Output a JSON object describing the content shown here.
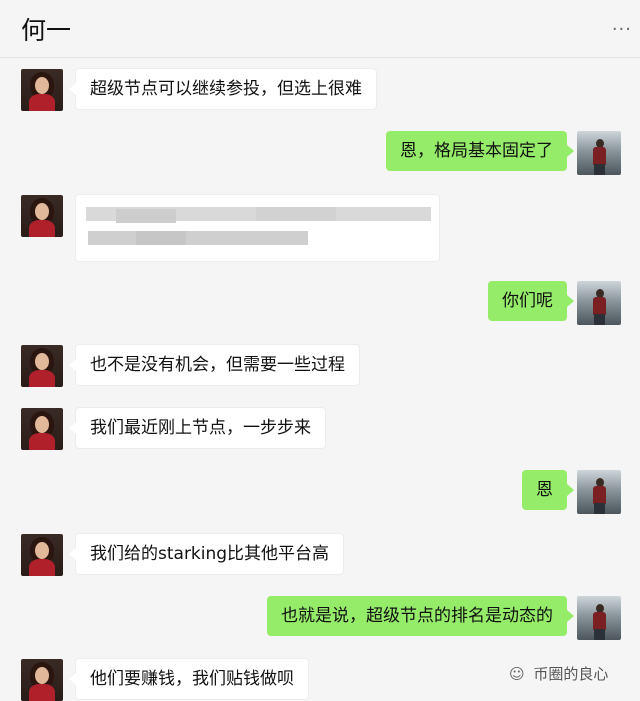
{
  "header": {
    "title": "何一",
    "more_icon": "···"
  },
  "messages": [
    {
      "side": "in",
      "text": "超级节点可以继续参投，但选上很难"
    },
    {
      "side": "out",
      "text": "恩，格局基本固定了"
    },
    {
      "side": "in",
      "text": "",
      "blurred": true
    },
    {
      "side": "out",
      "text": "你们呢"
    },
    {
      "side": "in",
      "text": "也不是没有机会，但需要一些过程"
    },
    {
      "side": "in",
      "text": "我们最近刚上节点，一步步来"
    },
    {
      "side": "out",
      "text": "恩"
    },
    {
      "side": "in",
      "text": "我们给的starking比其他平台高"
    },
    {
      "side": "out",
      "text": "也就是说，超级节点的排名是动态的"
    },
    {
      "side": "in",
      "text": "他们要赚钱，我们贴钱做呗"
    }
  ],
  "watermark": {
    "icon": "wechat-icon",
    "text": "币圈的良心"
  },
  "colors": {
    "background": "#f5f5f5",
    "incoming_bubble": "#ffffff",
    "outgoing_bubble": "#95ec69"
  }
}
